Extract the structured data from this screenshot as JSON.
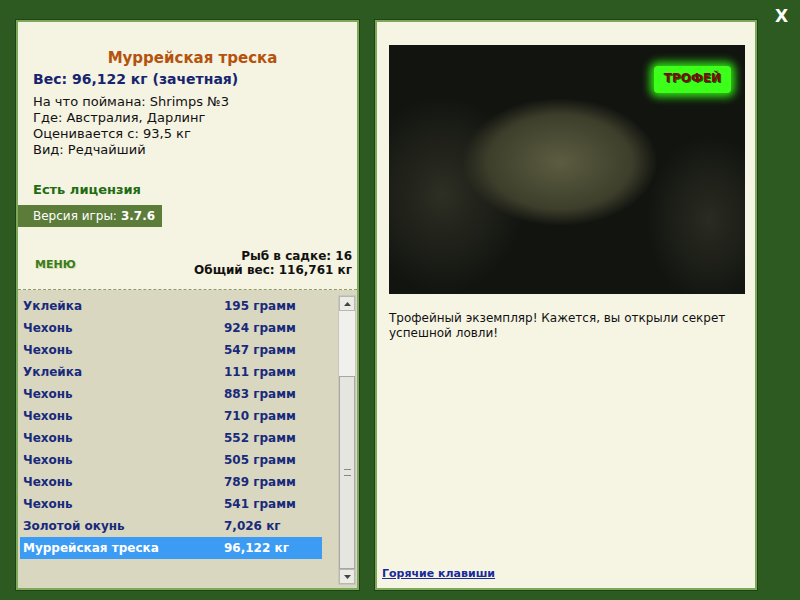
{
  "window": {
    "close": "X"
  },
  "fish": {
    "title": "Муррейская треска",
    "weight": "Вес: 96,122 кг (зачетная)",
    "details": [
      "На что поймана: Shrimps №3",
      "Где: Австралия, Дарлинг",
      "Оценивается с: 93,5 кг",
      "Вид: Редчайший"
    ],
    "license": "Есть лицензия",
    "version_label": "Версия игры:",
    "version": "3.7.6"
  },
  "menu": "МЕНЮ",
  "keepnet": {
    "count": "Рыб в садке: 16",
    "total": "Общий вес: 116,761 кг"
  },
  "catch_list": {
    "rows": [
      {
        "name": "Уклейка",
        "weight": "195 грамм",
        "selected": false
      },
      {
        "name": "Чехонь",
        "weight": "924 грамм",
        "selected": false
      },
      {
        "name": "Чехонь",
        "weight": "547 грамм",
        "selected": false
      },
      {
        "name": "Уклейка",
        "weight": "111 грамм",
        "selected": false
      },
      {
        "name": "Чехонь",
        "weight": "883 грамм",
        "selected": false
      },
      {
        "name": "Чехонь",
        "weight": "710 грамм",
        "selected": false
      },
      {
        "name": "Чехонь",
        "weight": "552 грамм",
        "selected": false
      },
      {
        "name": "Чехонь",
        "weight": "505 грамм",
        "selected": false
      },
      {
        "name": "Чехонь",
        "weight": "789 грамм",
        "selected": false
      },
      {
        "name": "Чехонь",
        "weight": "541 грамм",
        "selected": false
      },
      {
        "name": "Золотой окунь",
        "weight": "7,026 кг",
        "selected": false
      },
      {
        "name": "Муррейская треска",
        "weight": "96,122 кг",
        "selected": true
      }
    ],
    "scroll": {
      "position": 1,
      "visible_share": 0.75
    }
  },
  "photo": {
    "badge": "ТРОФЕЙ"
  },
  "message": "Трофейный экземпляр! Кажется, вы открыли секрет успешной ловли!",
  "hotkeys": "Горячие клавиши"
}
